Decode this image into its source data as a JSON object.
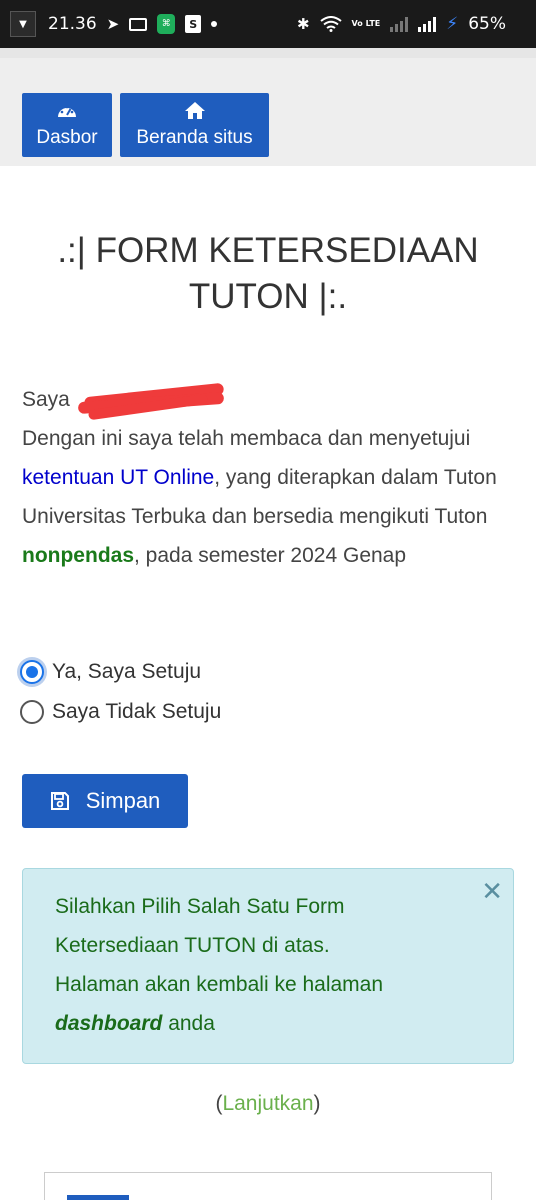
{
  "status_bar": {
    "time": "21.36",
    "volte_label": "Vo LTE",
    "battery": "65%"
  },
  "nav": {
    "dashboard_label": "Dasbor",
    "dashboard_icon": "speedometer-icon",
    "home_label": "Beranda situs",
    "home_icon": "home-icon"
  },
  "title": ".:| FORM KETERSEDIAAN TUTON |:.",
  "statement": {
    "saya": "Saya",
    "line1": "Dengan ini saya telah membaca dan menyetujui ",
    "link": "ketentuan UT Online",
    "line2": ", yang diterapkan dalam Tuton Universitas Terbuka dan bersedia mengikuti Tuton ",
    "program": "nonpendas",
    "line3": ", pada semester 2024 Genap"
  },
  "options": {
    "agree": "Ya, Saya Setuju",
    "disagree": "Saya Tidak Setuju",
    "selected": "agree"
  },
  "save_button": "Simpan",
  "alert": {
    "text1": "Silahkan Pilih Salah Satu Form Ketersediaan TUTON di atas.",
    "text2": " Halaman akan kembali ke halaman ",
    "emphasis": "dashboard",
    "text3": " anda",
    "close_icon": "close-icon"
  },
  "continue": {
    "open": "(",
    "link": "Lanjutkan",
    "close": ")"
  },
  "colors": {
    "primary": "#1f5dbe",
    "alert_bg": "#d1ecf1",
    "green_text": "#1a7a1a",
    "link_blue": "#0000cc",
    "continue_link": "#6ab04c"
  }
}
